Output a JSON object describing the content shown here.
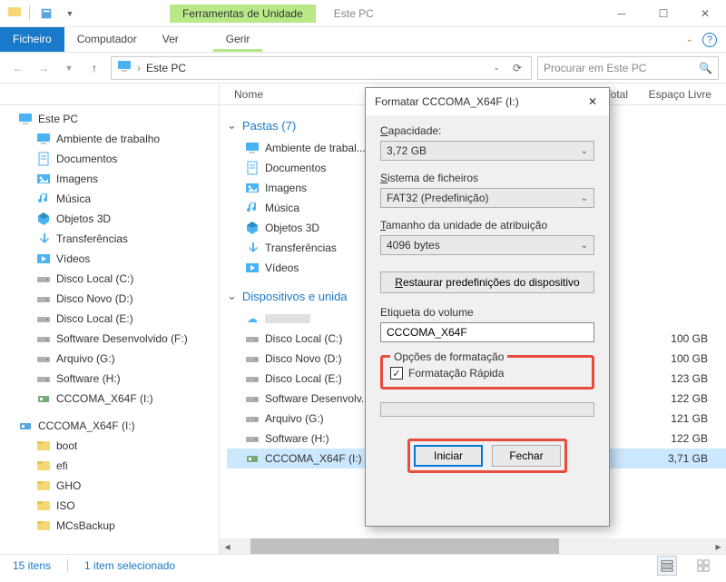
{
  "titlebar": {
    "context_tab": "Ferramentas de Unidade",
    "title": "Este PC"
  },
  "ribbon": {
    "file": "Ficheiro",
    "computer": "Computador",
    "view": "Ver",
    "manage": "Gerir"
  },
  "addressbar": {
    "crumb": "Este PC",
    "search_placeholder": "Procurar em Este PC"
  },
  "headers": {
    "name": "Nome",
    "total": "o Total",
    "free": "Espaço Livre"
  },
  "tree": {
    "este_pc": "Este PC",
    "items": [
      "Ambiente de trabalho",
      "Documentos",
      "Imagens",
      "Música",
      "Objetos 3D",
      "Transferências",
      "Vídeos",
      "Disco Local (C:)",
      "Disco Novo (D:)",
      "Disco Local (E:)",
      "Software Desenvolvido (F:)",
      "Arquivo (G:)",
      "Software (H:)",
      "CCCOMA_X64F (I:)"
    ],
    "removable": "CCCOMA_X64F (I:)",
    "removable_items": [
      "boot",
      "efi",
      "GHO",
      "ISO",
      "MCsBackup"
    ]
  },
  "content": {
    "group_folders": "Pastas (7)",
    "folders": [
      "Ambiente de trabal...",
      "Documentos",
      "Imagens",
      "Música",
      "Objetos 3D",
      "Transferências",
      "Vídeos"
    ],
    "group_drives": "Dispositivos e unida",
    "cloud": "",
    "drives": [
      {
        "name": "Disco Local (C:)",
        "size": "100 GB"
      },
      {
        "name": "Disco Novo (D:)",
        "size": "100 GB"
      },
      {
        "name": "Disco Local (E:)",
        "size": "123 GB"
      },
      {
        "name": "Software Desenvolv...",
        "size": "122 GB"
      },
      {
        "name": "Arquivo (G:)",
        "size": "121 GB"
      },
      {
        "name": "Software (H:)",
        "size": "122 GB"
      },
      {
        "name": "CCCOMA_X64F (I:)",
        "size": "3,71 GB"
      }
    ]
  },
  "statusbar": {
    "count": "15 itens",
    "selected": "1 item selecionado"
  },
  "dialog": {
    "title": "Formatar CCCOMA_X64F (I:)",
    "capacity_label": "Capacidade:",
    "capacity_value": "3,72 GB",
    "fs_label": "Sistema de ficheiros",
    "fs_value": "FAT32 (Predefinição)",
    "alloc_label": "Tamanho da unidade de atribuição",
    "alloc_value": "4096 bytes",
    "restore_btn": "Restaurar predefinições do dispositivo",
    "volume_label": "Etiqueta do volume",
    "volume_value": "CCCOMA_X64F",
    "options_label": "Opções de formatação",
    "quick_format": "Formatação Rápida",
    "start_btn": "Iniciar",
    "close_btn": "Fechar"
  }
}
